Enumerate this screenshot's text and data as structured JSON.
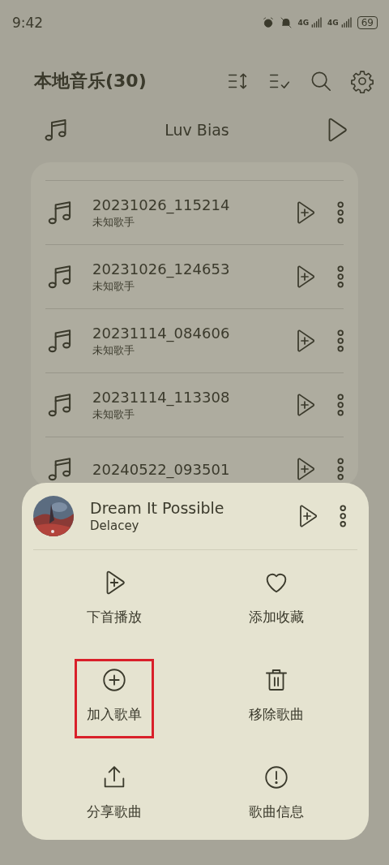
{
  "status_bar": {
    "time": "9:42",
    "networks": [
      "4G",
      "4G"
    ],
    "battery": "69"
  },
  "header": {
    "title": "本地音乐(30)"
  },
  "now_playing": {
    "title": "Luv Bias"
  },
  "songs": [
    {
      "title": "20231026_115214",
      "artist": "未知歌手"
    },
    {
      "title": "20231026_124653",
      "artist": "未知歌手"
    },
    {
      "title": "20231114_084606",
      "artist": "未知歌手"
    },
    {
      "title": "20231114_113308",
      "artist": "未知歌手"
    },
    {
      "title": "20240522_093501"
    }
  ],
  "sheet": {
    "song": {
      "title": "Dream It Possible",
      "artist": "Delacey"
    },
    "actions": [
      {
        "kind": "play-next",
        "label": "下首播放",
        "highlighted": false
      },
      {
        "kind": "favorite",
        "label": "添加收藏",
        "highlighted": false
      },
      {
        "kind": "add-playlist",
        "label": "加入歌单",
        "highlighted": true
      },
      {
        "kind": "remove",
        "label": "移除歌曲",
        "highlighted": false
      },
      {
        "kind": "share",
        "label": "分享歌曲",
        "highlighted": false
      },
      {
        "kind": "info",
        "label": "歌曲信息",
        "highlighted": false
      }
    ]
  }
}
